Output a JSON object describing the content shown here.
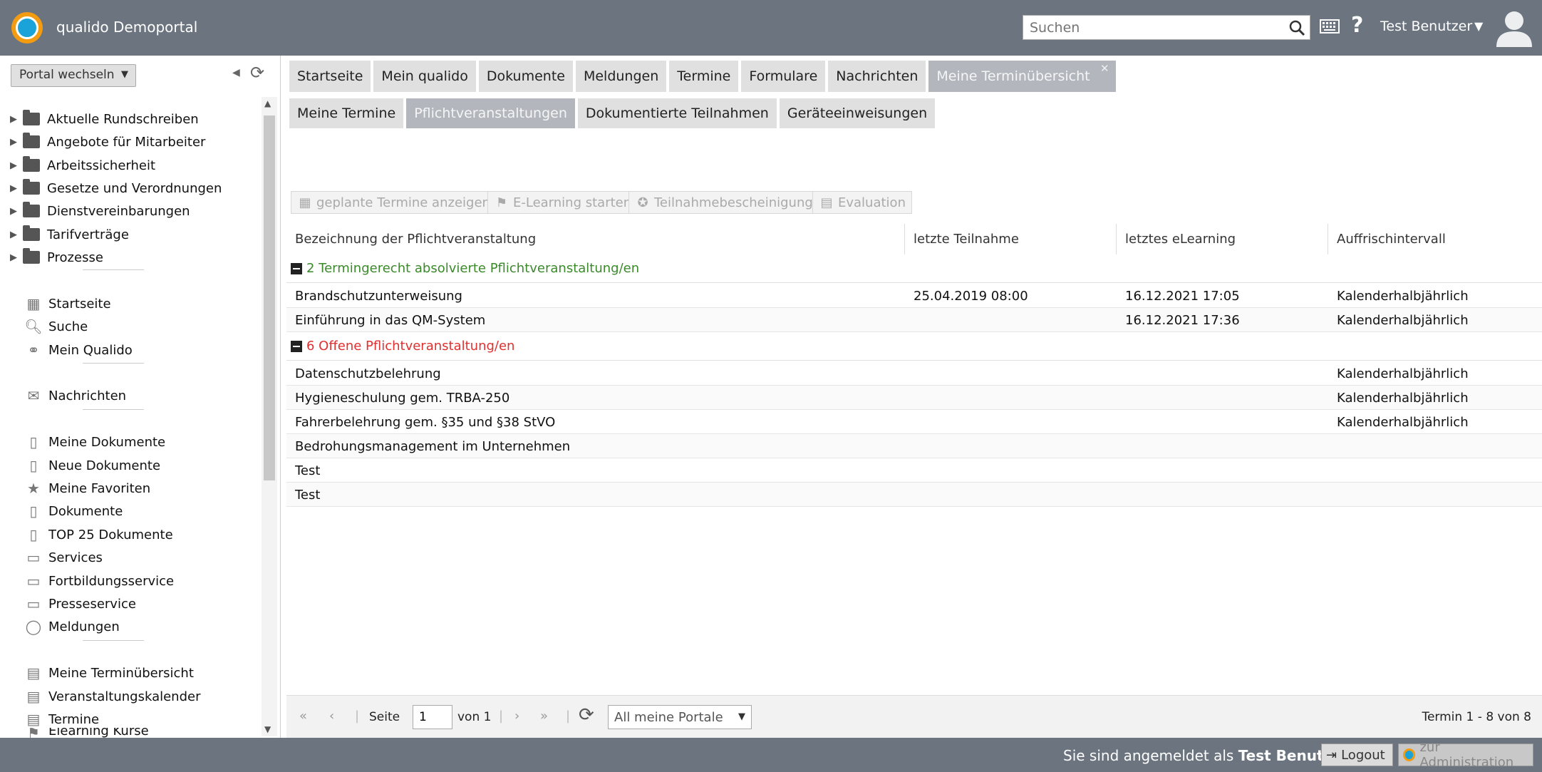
{
  "header": {
    "app_title": "qualido Demoportal",
    "search_placeholder": "Suchen",
    "help": "?",
    "user_name": "Test Benutzer"
  },
  "sidebar": {
    "portal_switch": "Portal wechseln",
    "folders": [
      "Aktuelle Rundschreiben",
      "Angebote für Mitarbeiter",
      "Arbeitssicherheit",
      "Gesetze und Verordnungen",
      "Dienstvereinbarungen",
      "Tarifverträge",
      "Prozesse"
    ],
    "nav": [
      {
        "label": "Startseite",
        "icon": "grid-icon"
      },
      {
        "label": "Suche",
        "icon": "search-icon"
      },
      {
        "label": "Mein Qualido",
        "icon": "circles-icon"
      },
      {
        "label": "Nachrichten",
        "icon": "envelope-icon"
      },
      {
        "label": "Meine Dokumente",
        "icon": "document-icon"
      },
      {
        "label": "Neue Dokumente",
        "icon": "document-icon"
      },
      {
        "label": "Meine Favoriten",
        "icon": "star-icon"
      },
      {
        "label": "Dokumente",
        "icon": "document-icon"
      },
      {
        "label": "TOP 25 Dokumente",
        "icon": "document-icon"
      },
      {
        "label": "Services",
        "icon": "book-icon"
      },
      {
        "label": "Fortbildungsservice",
        "icon": "book-icon"
      },
      {
        "label": "Presseservice",
        "icon": "book-icon"
      },
      {
        "label": "Meldungen",
        "icon": "speech-bubble-icon"
      },
      {
        "label": "Meine Terminübersicht",
        "icon": "calendar-icon"
      },
      {
        "label": "Veranstaltungskalender",
        "icon": "calendar-icon"
      },
      {
        "label": "Termine",
        "icon": "calendar-icon"
      },
      {
        "label": "Elearning Kurse",
        "icon": "elearning-icon"
      }
    ]
  },
  "tabs": [
    "Startseite",
    "Mein qualido",
    "Dokumente",
    "Meldungen",
    "Termine",
    "Formulare",
    "Nachrichten",
    "Meine Terminübersicht"
  ],
  "subtabs": [
    "Meine Termine",
    "Pflichtveranstaltungen",
    "Dokumentierte Teilnahmen",
    "Geräteeinweisungen"
  ],
  "toolbar": [
    "geplante Termine anzeigen",
    "E-Learning starten",
    "Teilnahmebescheinigung",
    "Evaluation"
  ],
  "grid": {
    "columns": [
      "Bezeichnung der Pflichtveranstaltung",
      "letzte Teilnahme",
      "letztes eLearning",
      "Auffrischintervall"
    ],
    "group1": "2 Termingerecht absolvierte Pflichtveranstaltung/en",
    "group1_rows": [
      [
        "Brandschutzunterweisung",
        "25.04.2019 08:00",
        "16.12.2021 17:05",
        "Kalenderhalbjährlich"
      ],
      [
        "Einführung in das QM-System",
        "",
        "16.12.2021 17:36",
        "Kalenderhalbjährlich"
      ]
    ],
    "group2": "6 Offene Pflichtveranstaltung/en",
    "group2_rows": [
      [
        "Datenschutzbelehrung",
        "",
        "",
        "Kalenderhalbjährlich"
      ],
      [
        "Hygieneschulung gem. TRBA-250",
        "",
        "",
        "Kalenderhalbjährlich"
      ],
      [
        "Fahrerbelehrung gem. §35 und §38 StVO",
        "",
        "",
        "Kalenderhalbjährlich"
      ],
      [
        "Bedrohungsmanagement im Unternehmen",
        "",
        "",
        ""
      ],
      [
        "Test",
        "",
        "",
        ""
      ],
      [
        "Test",
        "",
        "",
        ""
      ]
    ],
    "group1_color": "#3a8a2a",
    "group2_color": "#e03030"
  },
  "pager": {
    "page_label": "Seite",
    "page_value": "1",
    "of_label": "von 1",
    "portal_select": "All meine Portale",
    "count": "Termin 1 - 8 von 8"
  },
  "footer": {
    "prefix": "Sie sind angemeldet als",
    "user": "Test Benutzer",
    "logout": "Logout",
    "admin": "zur Administration"
  }
}
